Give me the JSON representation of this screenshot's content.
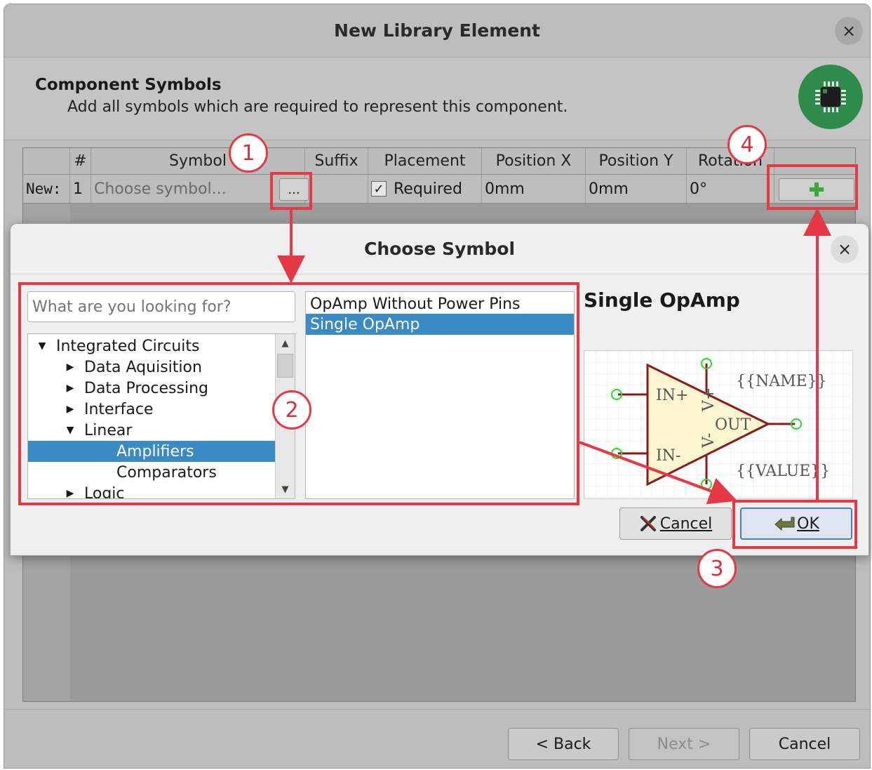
{
  "wizard": {
    "title": "New Library Element",
    "close_glyph": "×",
    "page_title": "Component Symbols",
    "page_subtitle": "Add all symbols which are required to represent this component.",
    "table": {
      "headers": [
        "#",
        "Symbol",
        "Suffix",
        "Placement",
        "Position X",
        "Position Y",
        "Rotation"
      ],
      "new_row": {
        "label": "New:",
        "number": "1",
        "symbol_placeholder": "Choose symbol...",
        "browse_label": "...",
        "placement": "Required",
        "placement_checked": true,
        "position_x": "0mm",
        "position_y": "0mm",
        "rotation": "0°",
        "add_icon": "plus-icon"
      }
    },
    "footer": {
      "back": "< Back",
      "next": "Next >",
      "cancel": "Cancel"
    }
  },
  "dialog": {
    "title": "Choose Symbol",
    "close_glyph": "×",
    "search_placeholder": "What are you looking for?",
    "tree": [
      {
        "label": "Integrated Circuits",
        "expanded": true,
        "level": 0
      },
      {
        "label": "Data Aquisition",
        "expanded": false,
        "level": 1
      },
      {
        "label": "Data Processing",
        "expanded": false,
        "level": 1
      },
      {
        "label": "Interface",
        "expanded": false,
        "level": 1
      },
      {
        "label": "Linear",
        "expanded": true,
        "level": 1
      },
      {
        "label": "Amplifiers",
        "level": 2,
        "selected": true
      },
      {
        "label": "Comparators",
        "level": 2
      },
      {
        "label": "Logic",
        "expanded": false,
        "level": 1
      }
    ],
    "symbols": [
      {
        "label": "OpAmp Without Power Pins",
        "selected": false
      },
      {
        "label": "Single OpAmp",
        "selected": true
      }
    ],
    "preview": {
      "title": "Single OpAmp",
      "labels": {
        "name": "{{NAME}}",
        "value": "{{VALUE}}",
        "in_plus": "IN+",
        "in_minus": "IN-",
        "out": "OUT",
        "v_plus": "V+",
        "v_minus": "V-"
      }
    },
    "cancel_label": "Cancel",
    "ok_label": "OK"
  },
  "annotations": {
    "badges": [
      "1",
      "2",
      "3",
      "4"
    ],
    "color": "#e53945"
  },
  "colors": {
    "selection": "#3a8ac4",
    "logo_green": "#2e8b4a",
    "add_green": "#3aa83a"
  }
}
